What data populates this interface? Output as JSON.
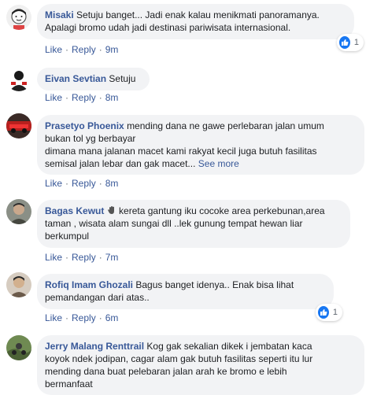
{
  "actions": {
    "like": "Like",
    "reply": "Reply",
    "separator": "·"
  },
  "see_more": "See more",
  "colors": {
    "name": "#385898",
    "bubble": "#f2f3f5",
    "meta": "#606770",
    "like_blue": "#1877f2"
  },
  "comments": [
    {
      "author": "Misaki",
      "lines": [
        "Setuju banget... Jadi enak kalau menikmati panoramanya.",
        "Apalagi bromo udah jadi destinasi pariwisata internasional."
      ],
      "time": "9m",
      "reactions": {
        "icon": "like-icon",
        "count": "1"
      }
    },
    {
      "author": "Eivan Sevtian",
      "lines": [
        "Setuju"
      ],
      "time": "8m"
    },
    {
      "author": "Prasetyo Phoenix",
      "lines": [
        "mending dana ne gawe perlebaran jalan umum",
        "bukan tol yg berbayar",
        "dimana mana jalanan macet kami rakyat kecil juga butuh fasilitas",
        "semisal jalan lebar dan gak macet..."
      ],
      "time": "8m"
    },
    {
      "author": "Bagas Kewut",
      "lines": [
        "kereta gantung iku cocoke area perkebunan,area",
        "taman , wisata alam sungai dll ..lek gunung tempat hewan liar",
        "berkumpul"
      ],
      "time": "7m"
    },
    {
      "author": "Rofiq Imam Ghozali",
      "lines": [
        "Bagus banget idenya.. Enak bisa lihat",
        "pemandangan dari atas.."
      ],
      "time": "6m",
      "reactions": {
        "icon": "like-icon",
        "count": "1"
      }
    },
    {
      "author": "Jerry Malang Renttrail",
      "lines": [
        "Kog gak sekalian dikek i jembatan kaca",
        "koyok ndek jodipan, cagar alam gak butuh fasilitas seperti itu lur",
        "mending dana buat pelebaran jalan arah ke bromo e lebih",
        "bermanfaat"
      ]
    }
  ]
}
